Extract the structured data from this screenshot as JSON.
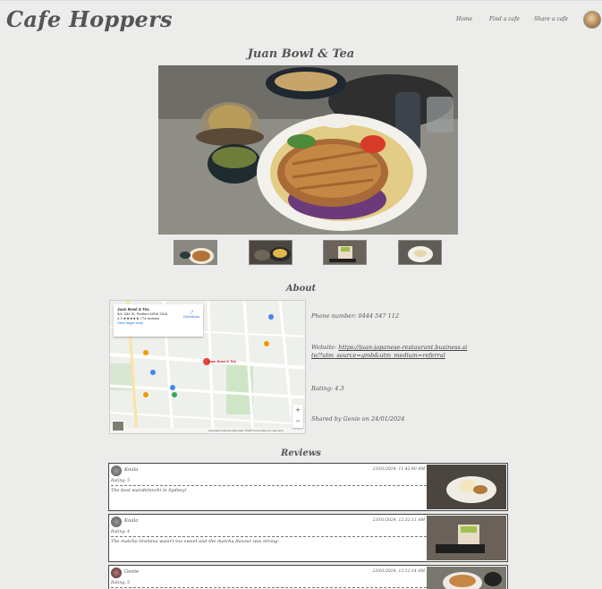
{
  "header": {
    "brand": "Cafe Hoppers",
    "nav": {
      "home": "Home",
      "find": "Find a cafe",
      "share": "Share a cafe"
    }
  },
  "cafe": {
    "name": "Juan Bowl & Tea"
  },
  "about": {
    "heading": "About",
    "phone": "Phone number: 0444 547 112",
    "website_prefix": "Website: ",
    "website_link": "https://juan-japanese-restaurant.business.site/?utm_source=gmb&utm_medium=referral",
    "rating": "Rating: 4.3",
    "shared_by": "Shared by Genie on 24/01/2024"
  },
  "map": {
    "place_name": "Juan Bowl & Tea",
    "address": "5/4, 284 St, Redfern NSW 2016",
    "rating_line": "4.3 ★★★★★  774 reviews",
    "larger_map": "View larger map",
    "directions": "Directions",
    "pin_label": "Juan Bowl & Tea",
    "footer": "Keyboard shortcuts  Map data ©2024  Terms  Report a map error",
    "zoom_in": "+",
    "zoom_out": "−"
  },
  "reviews": {
    "heading": "Reviews",
    "items": [
      {
        "name": "Koala",
        "date": "23/01/2024, 11:42:40 AM",
        "rating": "Rating: 5",
        "text": "The best warabimochi in Sydney!"
      },
      {
        "name": "Koala",
        "date": "23/01/2024, 12:32:11 AM",
        "rating": "Rating: 4",
        "text": "The matcha tiramisu wasn't too sweet and the matcha flavour was strong."
      },
      {
        "name": "Genie",
        "date": "23/01/2024, 12:12:14 AM",
        "rating": "Rating: 5",
        "text": ""
      }
    ]
  }
}
